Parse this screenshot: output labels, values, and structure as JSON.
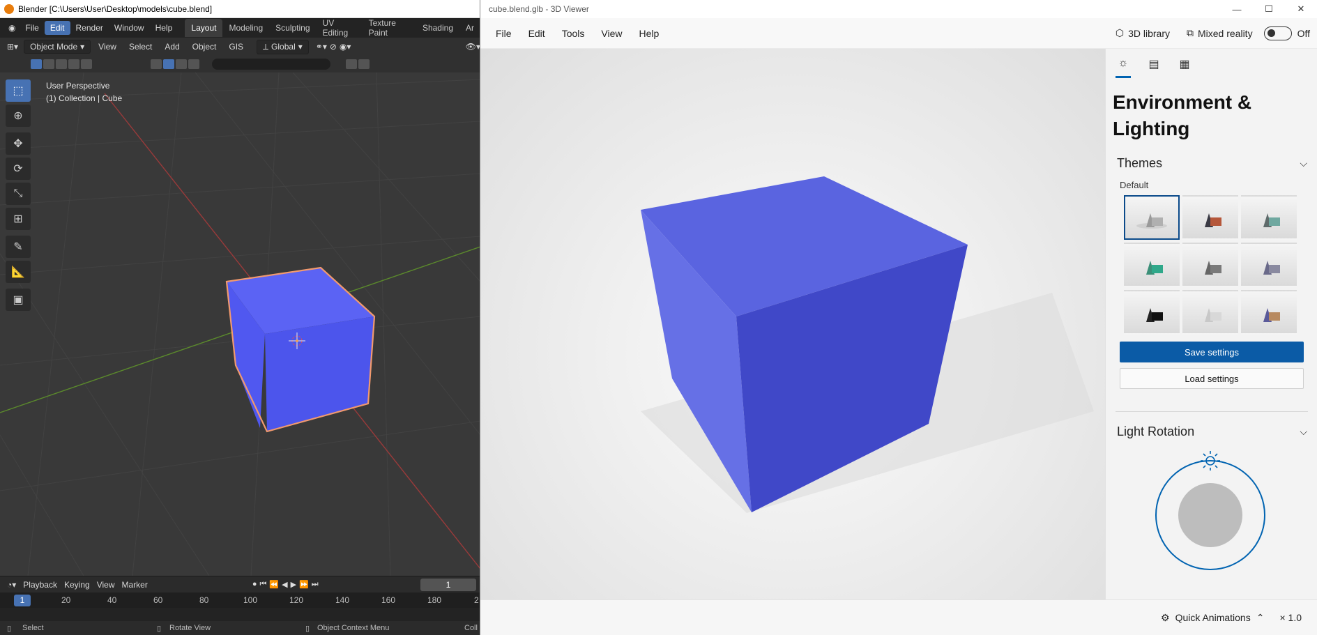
{
  "blender": {
    "title": "Blender [C:\\Users\\User\\Desktop\\models\\cube.blend]",
    "menu": [
      "File",
      "Edit",
      "Render",
      "Window",
      "Help"
    ],
    "workspaces": [
      "Layout",
      "Modeling",
      "Sculpting",
      "UV Editing",
      "Texture Paint",
      "Shading",
      "Ar"
    ],
    "header": {
      "mode": "Object Mode",
      "items": [
        "View",
        "Select",
        "Add",
        "Object",
        "GIS"
      ],
      "orientation": "Global"
    },
    "overlay": {
      "line1": "User Perspective",
      "line2": "(1) Collection | Cube"
    },
    "timeline": {
      "menus": [
        "Playback",
        "Keying",
        "View",
        "Marker"
      ],
      "current_frame": "1",
      "ticks": [
        "20",
        "40",
        "60",
        "80",
        "100",
        "120",
        "140",
        "160",
        "180",
        "2"
      ],
      "cursor_label": "1"
    },
    "status": {
      "select": "Select",
      "rotate": "Rotate View",
      "context": "Object Context Menu",
      "trail": "Coll"
    },
    "colors": {
      "accent": "#4772b3",
      "cube": "#4d5bf2",
      "outline": "#f29a6e"
    }
  },
  "viewer": {
    "title": "cube.blend.glb - 3D Viewer",
    "menu": [
      "File",
      "Edit",
      "Tools",
      "View",
      "Help"
    ],
    "library_label": "3D library",
    "mixed_reality_label": "Mixed reality",
    "toggle_state": "Off",
    "panel": {
      "heading": "Environment & Lighting",
      "themes_label": "Themes",
      "themes_sub": "Default",
      "save_label": "Save settings",
      "load_label": "Load settings",
      "light_rotation_label": "Light Rotation"
    },
    "bottom": {
      "quick_animations": "Quick Animations",
      "speed": "× 1.0"
    },
    "colors": {
      "accent": "#0063b1",
      "cube_top": "#5a64e0",
      "cube_left": "#6670e6",
      "cube_right": "#4048c8"
    }
  }
}
